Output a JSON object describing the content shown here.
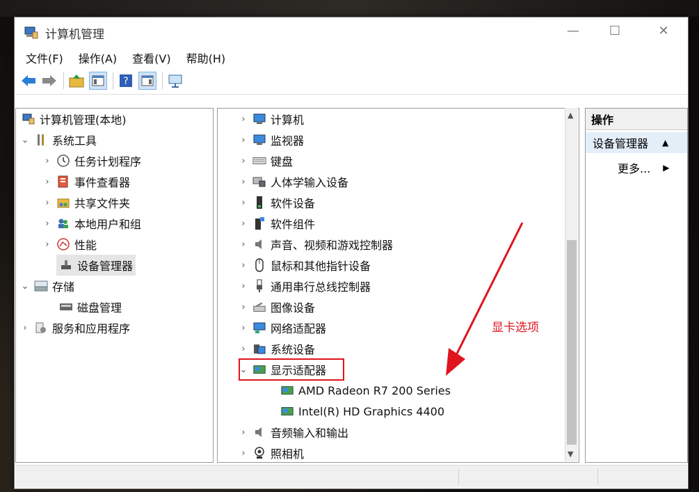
{
  "window": {
    "title": "计算机管理"
  },
  "menu": [
    "文件(F)",
    "操作(A)",
    "查看(V)",
    "帮助(H)"
  ],
  "toolbar": [
    "back-icon",
    "forward-icon",
    "up-folder-icon",
    "show-tree-icon",
    "help-icon",
    "show-action-pane-icon",
    "console-icon"
  ],
  "tree": {
    "root": "计算机管理(本地)",
    "system_tools": "系统工具",
    "items": [
      "任务计划程序",
      "事件查看器",
      "共享文件夹",
      "本地用户和组",
      "性能",
      "设备管理器"
    ],
    "storage": "存储",
    "disk_mgmt": "磁盘管理",
    "services": "服务和应用程序"
  },
  "devices": [
    "计算机",
    "监视器",
    "键盘",
    "人体学输入设备",
    "软件设备",
    "软件组件",
    "声音、视频和游戏控制器",
    "鼠标和其他指针设备",
    "通用串行总线控制器",
    "图像设备",
    "网络适配器",
    "系统设备",
    "显示适配器"
  ],
  "display_adapters": [
    "AMD Radeon R7 200 Series",
    "Intel(R) HD Graphics 4400"
  ],
  "devices_after": [
    "音频输入和输出",
    "照相机"
  ],
  "actions": {
    "header": "操作",
    "section": "设备管理器",
    "more": "更多..."
  },
  "annotation": "显卡选项",
  "colors": {
    "annotation": "#e0141e",
    "selection": "#e5e5e5"
  }
}
